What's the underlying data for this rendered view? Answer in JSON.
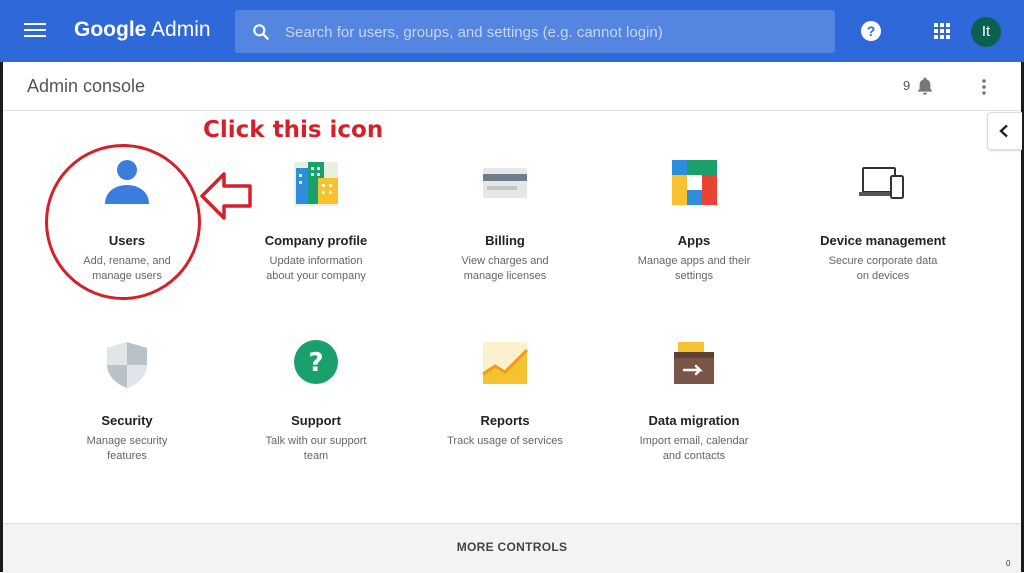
{
  "header": {
    "brand_google": "Google",
    "brand_admin": "Admin",
    "search_placeholder": "Search for users, groups, and settings (e.g. cannot login)",
    "help_glyph": "?",
    "avatar_initials": "It",
    "accent_color": "#2f68d8"
  },
  "subbar": {
    "title": "Admin console",
    "notification_count": "9"
  },
  "annotation": {
    "text": "Click this icon",
    "color": "#d4202a"
  },
  "cards": [
    {
      "title": "Users",
      "desc1": "Add, rename, and",
      "desc2": "manage users",
      "icon": "users-icon"
    },
    {
      "title": "Company profile",
      "desc1": "Update information",
      "desc2": "about your company",
      "icon": "company-profile-icon"
    },
    {
      "title": "Billing",
      "desc1": "View charges and",
      "desc2": "manage licenses",
      "icon": "billing-icon"
    },
    {
      "title": "Apps",
      "desc1": "Manage apps and their",
      "desc2": "settings",
      "icon": "apps-icon"
    },
    {
      "title": "Device management",
      "desc1": "Secure corporate data",
      "desc2": "on devices",
      "icon": "device-icon"
    },
    {
      "title": "Security",
      "desc1": "Manage security",
      "desc2": "features",
      "icon": "security-icon"
    },
    {
      "title": "Support",
      "desc1": "Talk with our support",
      "desc2": "team",
      "icon": "support-icon"
    },
    {
      "title": "Reports",
      "desc1": "Track usage of services",
      "desc2": "",
      "icon": "reports-icon"
    },
    {
      "title": "Data migration",
      "desc1": "Import email, calendar",
      "desc2": "and contacts",
      "icon": "data-migration-icon"
    }
  ],
  "footer": {
    "more_controls": "MORE CONTROLS",
    "corner_digit": "0"
  }
}
